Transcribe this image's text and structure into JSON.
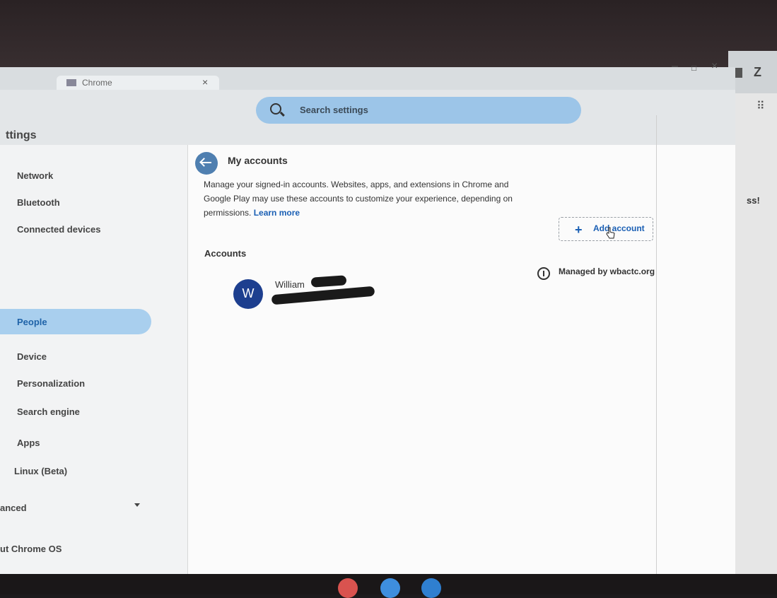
{
  "window": {
    "app_title": "ttings",
    "tab_title": "Chrome"
  },
  "search": {
    "placeholder": "Search settings"
  },
  "sidebar": {
    "items": [
      {
        "label": "Network"
      },
      {
        "label": "Bluetooth"
      },
      {
        "label": "Connected devices"
      },
      {
        "label": "People",
        "active": true
      },
      {
        "label": "Device"
      },
      {
        "label": "Personalization"
      },
      {
        "label": "Search engine"
      },
      {
        "label": "Apps"
      },
      {
        "label": "Linux (Beta)"
      }
    ],
    "advanced_label": "anced",
    "about_label": "ut Chrome OS"
  },
  "main": {
    "heading": "My accounts",
    "description": "Manage your signed-in accounts. Websites, apps, and extensions in Chrome and Google Play may use these accounts to customize your experience, depending on permissions.",
    "learn_more": "Learn more",
    "add_account_label": "Add account",
    "accounts_section": "Accounts",
    "account": {
      "avatar_letter": "W",
      "name": "William",
      "managed_by": "Managed by wbactc.org"
    }
  },
  "background_window": {
    "partial_text": "ss!",
    "letter": "Z"
  },
  "colors": {
    "accent": "#1a5fb4",
    "active_nav_bg": "#a9cfee",
    "search_bg": "#9cc5e8",
    "avatar_bg": "#1d3f8f"
  },
  "icons": [
    "search-icon",
    "back-arrow-icon",
    "plus-icon",
    "info-icon",
    "hand-cursor-icon",
    "chevron-down-icon"
  ]
}
